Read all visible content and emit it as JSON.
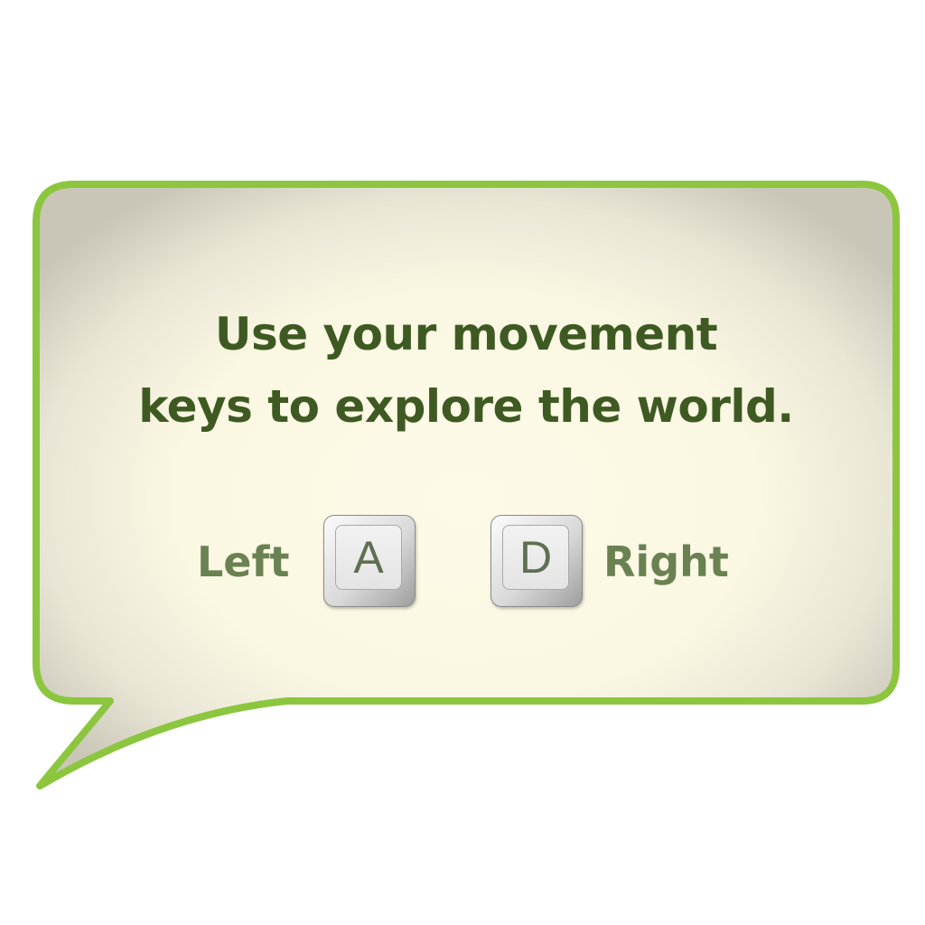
{
  "dialog": {
    "message_lines": [
      "Use your movement",
      "keys to explore the world."
    ]
  },
  "controls": {
    "left": {
      "label": "Left",
      "key": "A"
    },
    "right": {
      "label": "Right",
      "key": "D"
    }
  },
  "colors": {
    "bubble_border": "#8cc63f",
    "bubble_fill_center": "#fdfbe8",
    "bubble_fill_edge": "#cfccbf",
    "message_text": "#3e5a22",
    "control_label_text": "#6a8152",
    "key_letter": "#5f6f51"
  }
}
